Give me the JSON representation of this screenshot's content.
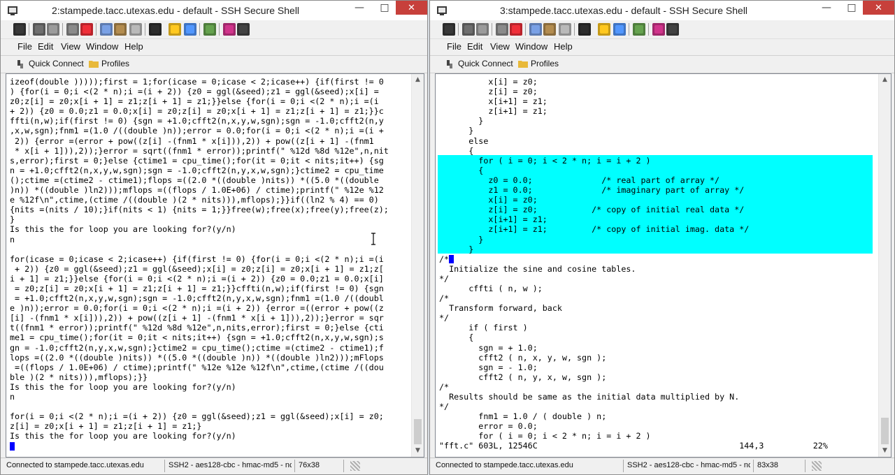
{
  "window_left": {
    "title": "2:stampede.tacc.utexas.edu - default - SSH Secure Shell",
    "menu": [
      "File",
      "Edit",
      "View",
      "Window",
      "Help"
    ],
    "quick_connect": "Quick Connect",
    "profiles": "Profiles",
    "terminal_text": "izeof(double )))));first = 1;for(icase = 0;icase < 2;icase++) {if(first != 0\n) {for(i = 0;i <(2 * n);i =(i + 2)) {z0 = ggl(&seed);z1 = ggl(&seed);x[i] =\nz0;z[i] = z0;x[i + 1] = z1;z[i + 1] = z1;}}else {for(i = 0;i <(2 * n);i =(i\n+ 2)) {z0 = 0.0;z1 = 0.0;x[i] = z0;z[i] = z0;x[i + 1] = z1;z[i + 1] = z1;}}c\nffti(n,w);if(first != 0) {sgn = +1.0;cfft2(n,x,y,w,sgn);sgn = -1.0;cfft2(n,y\n,x,w,sgn);fnm1 =(1.0 /((double )n));error = 0.0;for(i = 0;i <(2 * n);i =(i +\n 2)) {error =(error + pow((z[i] -(fnm1 * x[i])),2)) + pow((z[i + 1] -(fnm1\n * x[i + 1])),2));}error = sqrt((fnm1 * error));printf(\" %12d %8d %12e\",n,nit\ns,error);first = 0;}else {ctime1 = cpu_time();for(it = 0;it < nits;it++) {sg\nn = +1.0;cfft2(n,x,y,w,sgn);sgn = -1.0;cfft2(n,y,x,w,sgn);}ctime2 = cpu_time\n();ctime =(ctime2 - ctime1);flops =((2.0 *((double )nits)) *((5.0 *((double\n)n)) *((double )ln2)));mflops =((flops / 1.0E+06) / ctime);printf(\" %12e %12\ne %12f\\n\",ctime,(ctime /((double )(2 * nits))),mflops);}}if((ln2 % 4) == 0)\n{nits =(nits / 10);}if(nits < 1) {nits = 1;}}free(w);free(x);free(y);free(z);\n}\nIs this the for loop you are looking for?(y/n)\nn\n\nfor(icase = 0;icase < 2;icase++) {if(first != 0) {for(i = 0;i <(2 * n);i =(i\n + 2)) {z0 = ggl(&seed);z1 = ggl(&seed);x[i] = z0;z[i] = z0;x[i + 1] = z1;z[\ni + 1] = z1;}}else {for(i = 0;i <(2 * n);i =(i + 2)) {z0 = 0.0;z1 = 0.0;x[i]\n = z0;z[i] = z0;x[i + 1] = z1;z[i + 1] = z1;}}cffti(n,w);if(first != 0) {sgn\n = +1.0;cfft2(n,x,y,w,sgn);sgn = -1.0;cfft2(n,y,x,w,sgn);fnm1 =(1.0 /((doubl\ne )n));error = 0.0;for(i = 0;i <(2 * n);i =(i + 2)) {error =((error + pow((z\n[i] -(fnm1 * x[i])),2)) + pow((z[i + 1] -(fnm1 * x[i + 1])),2));}error = sqr\nt((fnm1 * error));printf(\" %12d %8d %12e\",n,nits,error);first = 0;}else {cti\nme1 = cpu_time();for(it = 0;it < nits;it++) {sgn = +1.0;cfft2(n,x,y,w,sgn);s\ngn = -1.0;cfft2(n,y,x,w,sgn);}ctime2 = cpu_time();ctime =(ctime2 - ctime1);f\nlops =((2.0 *((double )nits)) *((5.0 *((double )n)) *((double )ln2)));mFlops\n =((flops / 1.0E+06) / ctime);printf(\" %12e %12e %12f\\n\",ctime,(ctime /((dou\nble )(2 * nits))),mflops);}}\nIs this the for loop you are looking for?(y/n)\nn\n\nfor(i = 0;i <(2 * n);i =(i + 2)) {z0 = ggl(&seed);z1 = ggl(&seed);x[i] = z0;\nz[i] = z0;x[i + 1] = z1;z[i + 1] = z1;}\nIs this the for loop you are looking for?(y/n)",
    "status": {
      "connection": "Connected to stampede.tacc.utexas.edu",
      "cipher": "SSH2 - aes128-cbc - hmac-md5 - nc",
      "size": "76x38"
    }
  },
  "window_right": {
    "title": "3:stampede.tacc.utexas.edu - default - SSH Secure Shell",
    "menu": [
      "File",
      "Edit",
      "View",
      "Window",
      "Help"
    ],
    "quick_connect": "Quick Connect",
    "profiles": "Profiles",
    "terminal_text": "          x[i] = z0;\n          z[i] = z0;\n          x[i+1] = z1;\n          z[i+1] = z1;\n        }\n      }\n      else\n      {\n        for ( i = 0; i < 2 * n; i = i + 2 )\n        {\n          z0 = 0.0;              /* real part of array */\n          z1 = 0.0;              /* imaginary part of array */\n          x[i] = z0;\n          z[i] = z0;           /* copy of initial real data */\n          x[i+1] = z1;\n          z[i+1] = z1;         /* copy of initial imag. data */\n        }\n      }\n/*\n  Initialize the sine and cosine tables.\n*/\n      cffti ( n, w );\n/*\n  Transform forward, back\n*/\n      if ( first )\n      {\n        sgn = + 1.0;\n        cfft2 ( n, x, y, w, sgn );\n        sgn = - 1.0;\n        cfft2 ( n, y, x, w, sgn );\n/*\n  Results should be same as the initial data multiplied by N.\n*/\n        fnm1 = 1.0 / ( double ) n;\n        error = 0.0;\n        for ( i = 0; i < 2 * n; i = i + 2 )\n\"fft.c\" 603L, 12546C                                         144,3          22%",
    "status": {
      "connection": "Connected to stampede.tacc.utexas.edu",
      "cipher": "SSH2 - aes128-cbc - hmac-md5 - nc",
      "size": "83x38"
    }
  },
  "icons": [
    "save-icon",
    "print-icon",
    "print-preview-icon",
    "cut-icon",
    "delete-icon",
    "copy-icon",
    "paste-icon",
    "paste-special-icon",
    "find-icon",
    "sftp-icon",
    "transfer-icon",
    "settings-icon",
    "help-book-icon",
    "context-help-icon"
  ],
  "colors": {
    "selection_highlight": "#00ffff",
    "cursor": "#0000ff",
    "close_button": "#c7403b"
  }
}
